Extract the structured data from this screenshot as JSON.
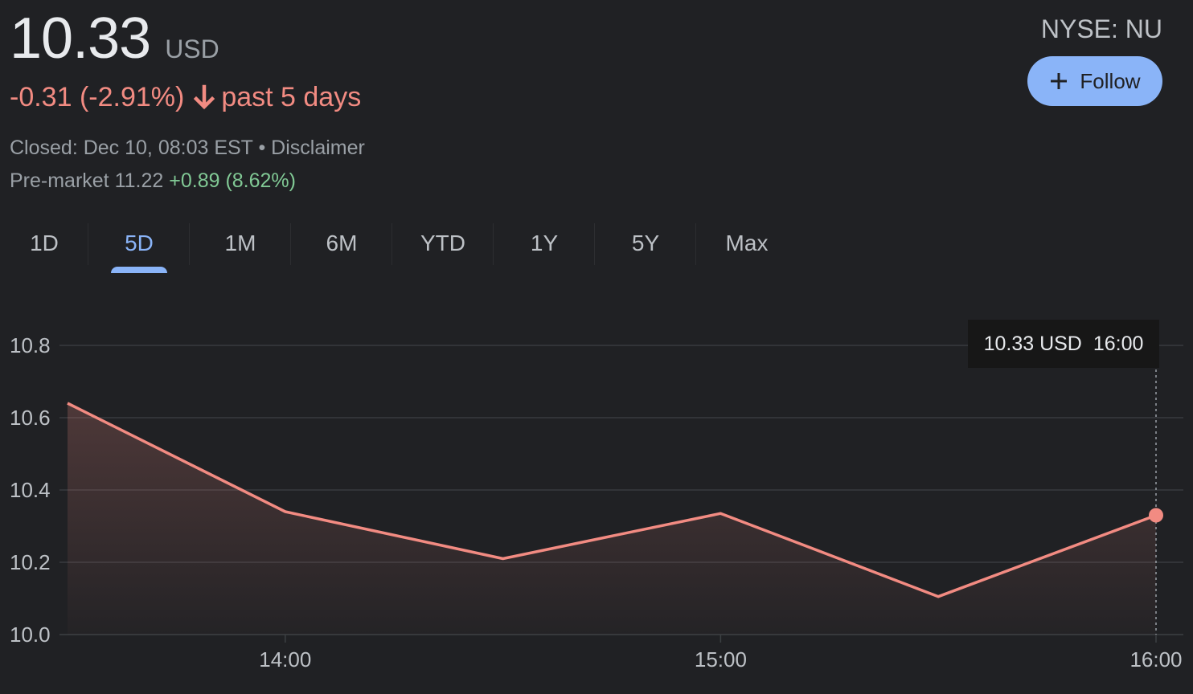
{
  "quote": {
    "price": "10.33",
    "currency": "USD",
    "change": "-0.31 (-2.91%)",
    "period": "past 5 days",
    "closed_text": "Closed: Dec 10, 08:03 EST",
    "separator": "•",
    "disclaimer": "Disclaimer",
    "premarket_label": "Pre-market 11.22",
    "premarket_change": "+0.89 (8.62%)",
    "ticker": "NYSE: NU",
    "follow_label": "Follow"
  },
  "tabs": [
    {
      "label": "1D",
      "active": false
    },
    {
      "label": "5D",
      "active": true
    },
    {
      "label": "1M",
      "active": false
    },
    {
      "label": "6M",
      "active": false
    },
    {
      "label": "YTD",
      "active": false
    },
    {
      "label": "1Y",
      "active": false
    },
    {
      "label": "5Y",
      "active": false
    },
    {
      "label": "Max",
      "active": false
    }
  ],
  "tooltip": {
    "value": "10.33 USD",
    "time": "16:00"
  },
  "colors": {
    "line": "#f28b82",
    "accent": "#8ab4f8",
    "positive": "#81c995",
    "grid": "#3c4043"
  },
  "chart_data": {
    "type": "line",
    "x": [
      "13:30",
      "14:00",
      "14:30",
      "15:00",
      "15:30",
      "16:00"
    ],
    "values": [
      10.64,
      10.34,
      10.21,
      10.335,
      10.105,
      10.33
    ],
    "x_ticks": [
      "14:00",
      "15:00",
      "16:00"
    ],
    "y_ticks": [
      "10.0",
      "10.2",
      "10.4",
      "10.6",
      "10.8"
    ],
    "ylim": [
      10.0,
      10.8
    ],
    "grid": true,
    "area_fill": true
  }
}
